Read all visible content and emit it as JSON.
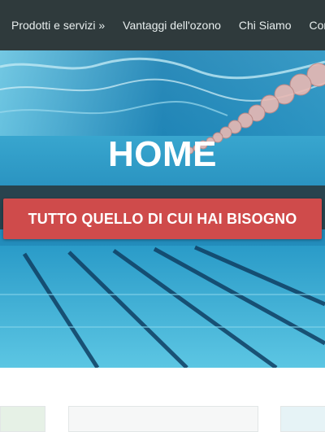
{
  "nav": {
    "items": [
      {
        "label": "Prodotti e servizi »"
      },
      {
        "label": "Vantaggi dell'ozono"
      },
      {
        "label": "Chi Siamo"
      },
      {
        "label": "Contatti"
      }
    ]
  },
  "hero": {
    "title": "HOME",
    "cta_label": "TUTTO QUELLO DI CUI HAI BISOGNO"
  },
  "colors": {
    "navbar": "#2f3a3c",
    "cta": "#cf4b4b",
    "water": "#36a9cf"
  }
}
